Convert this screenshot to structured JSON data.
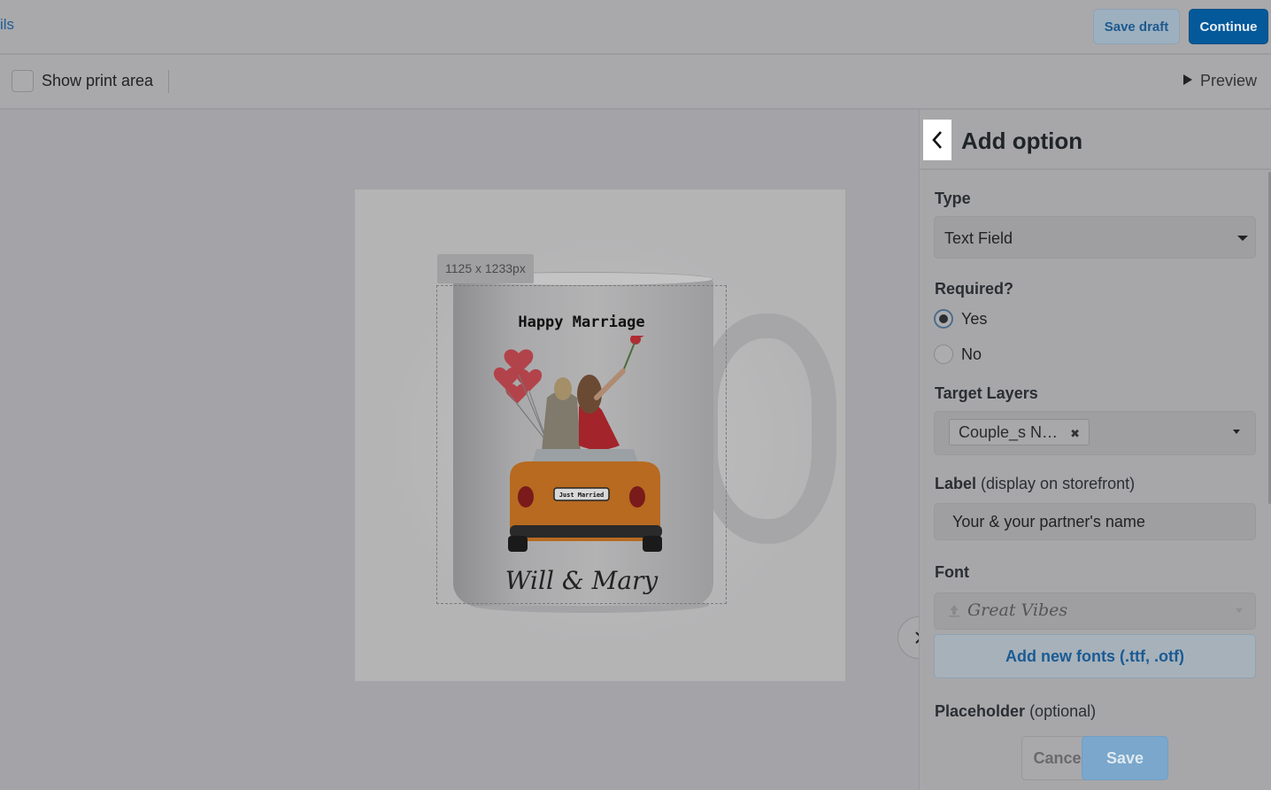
{
  "header": {
    "breadcrumb": "ils",
    "save_draft_label": "Save draft",
    "continue_label": "Continue"
  },
  "toolbar": {
    "show_print_area_label": "Show print area",
    "preview_label": "Preview"
  },
  "canvas": {
    "size_label": "1125 x 1233px",
    "mug_title": "Happy Marriage",
    "mug_names": "Will & Mary",
    "plate_text": "Just Married"
  },
  "panel": {
    "title": "Add option",
    "type": {
      "label": "Type",
      "value": "Text Field"
    },
    "required": {
      "label": "Required?",
      "options": [
        "Yes",
        "No"
      ],
      "selected": "Yes"
    },
    "target_layers": {
      "label": "Target Layers",
      "tag": "Couple_s N…"
    },
    "label_field": {
      "label": "Label",
      "label_suffix": "(display on storefront)",
      "value": "Your & your partner's name"
    },
    "font": {
      "label": "Font",
      "value": "Great Vibes",
      "add_fonts_label": "Add new fonts (.ttf, .otf)"
    },
    "placeholder": {
      "label": "Placeholder",
      "label_suffix": "(optional)"
    },
    "cancel_label": "Cancel",
    "save_label": "Save"
  },
  "colors": {
    "accent": "#04599a",
    "link": "#1a5b94",
    "overlay_gray": "#a4a4a8"
  }
}
